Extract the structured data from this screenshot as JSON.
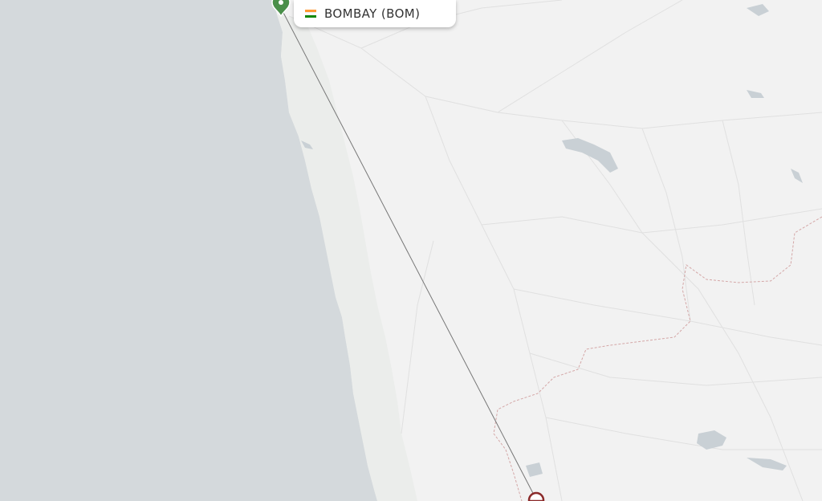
{
  "map": {
    "colors": {
      "sea": "#d4d9dc",
      "land": "#f2f2f2",
      "coast_land": "#e6e8e6",
      "road": "#e0e0e0",
      "water_body": "#c9d0d5",
      "border": "#d4a7a7",
      "route_line": "#777777",
      "origin_marker": "#4a8f4a",
      "destination_marker": "#8b2a2a"
    },
    "origin": {
      "label": "BOMBAY (BOM)",
      "flag_icon": "india-flag-icon",
      "marker_icon": "map-pin-icon"
    },
    "destination": {
      "marker_icon": "map-pin-icon"
    }
  }
}
